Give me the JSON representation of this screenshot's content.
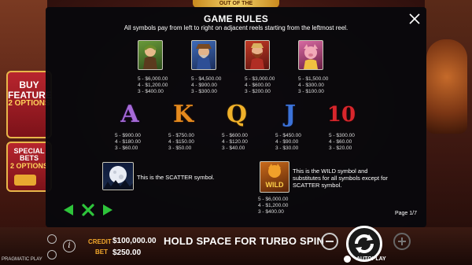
{
  "background": {
    "logo": "OUT OF THE",
    "buy_feature": {
      "line1": "BUY",
      "line2": "FEATURE",
      "line3": "2 OPTIONS"
    },
    "special_bets": {
      "line1": "SPECIAL",
      "line2": "BETS",
      "line3": "2 OPTIONS"
    }
  },
  "modal": {
    "title": "GAME RULES",
    "subtitle": "All symbols pay from left to right on adjacent reels starting from the leftmost reel.",
    "high_symbols": [
      {
        "icon": "hunter-woman-symbol-icon",
        "color": "#3d6b2c",
        "paytable": [
          "5 - $6,000.00",
          "4 - $1,200.00",
          "3 - $400.00"
        ]
      },
      {
        "icon": "blue-ranger-symbol-icon",
        "color": "#2b4c8a",
        "paytable": [
          "5 - $4,500.00",
          "4 - $900.00",
          "3 - $300.00"
        ]
      },
      {
        "icon": "bearded-man-symbol-icon",
        "color": "#9a2a1e",
        "paytable": [
          "5 - $3,000.00",
          "4 - $600.00",
          "3 - $200.00"
        ]
      },
      {
        "icon": "pig-lady-symbol-icon",
        "color": "#b0447a",
        "paytable": [
          "5 - $1,500.00",
          "4 - $300.00",
          "3 - $100.00"
        ]
      }
    ],
    "low_symbols": [
      {
        "glyph": "A",
        "icon": "letter-a-symbol-icon",
        "color": "#9b59d0",
        "paytable": [
          "5 - $900.00",
          "4 - $180.00",
          "3 - $60.00"
        ]
      },
      {
        "glyph": "K",
        "icon": "letter-k-symbol-icon",
        "color": "#e58a1e",
        "paytable": [
          "5 - $750.00",
          "4 - $150.00",
          "3 - $50.00"
        ]
      },
      {
        "glyph": "Q",
        "icon": "letter-q-symbol-icon",
        "color": "#f0b12a",
        "paytable": [
          "5 - $600.00",
          "4 - $120.00",
          "3 - $40.00"
        ]
      },
      {
        "glyph": "J",
        "icon": "letter-j-symbol-icon",
        "color": "#3b72d8",
        "paytable": [
          "5 - $450.00",
          "4 - $90.00",
          "3 - $30.00"
        ]
      },
      {
        "glyph": "10",
        "icon": "number-10-symbol-icon",
        "color": "#d8262c",
        "paytable": [
          "5 - $300.00",
          "4 - $60.00",
          "3 - $20.00"
        ]
      }
    ],
    "scatter": {
      "icon": "moon-scatter-symbol-icon",
      "text": "This is the SCATTER symbol."
    },
    "wild": {
      "icon": "wild-symbol-icon",
      "label": "WILD",
      "text": "This is the WILD symbol and substitutes for all symbols except for SCATTER symbol.",
      "paytable": [
        "5 - $6,000.00",
        "4 - $1,200.00",
        "3 - $400.00"
      ]
    },
    "page_info": "Page 1/7"
  },
  "bottom_bar": {
    "credit_label": "CREDIT",
    "credit_value": "$100,000.00",
    "bet_label": "BET",
    "bet_value": "$250.00",
    "message": "HOLD SPACE FOR TURBO SPIN",
    "autoplay_label": "AUTOPLAY",
    "brand": "PRAGMATIC PLAY"
  },
  "colors": {
    "accent_green": "#2ec43b",
    "credit_orange": "#f2a72b",
    "modal_bg": "#08080c"
  }
}
